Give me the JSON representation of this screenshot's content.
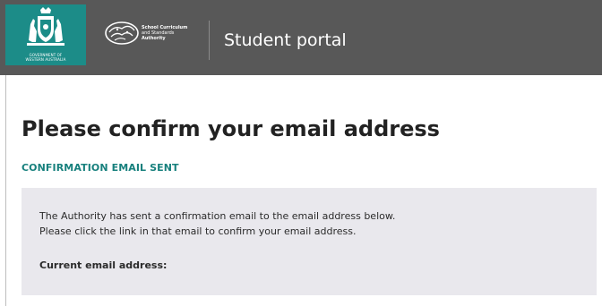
{
  "header": {
    "gov_logo_text_line1": "GOVERNMENT OF",
    "gov_logo_text_line2": "WESTERN AUSTRALIA",
    "scsa_line1": "School Curriculum",
    "scsa_line2": "and Standards",
    "scsa_line3": "Authority",
    "portal_title": "Student portal",
    "bar_color": "#585858",
    "crest_color": "#1c8c88"
  },
  "main": {
    "page_title": "Please confirm your email address",
    "status_heading": "CONFIRMATION EMAIL SENT",
    "message_line1": "The Authority has sent a confirmation email to the email address below.",
    "message_line2": "Please click the link in that email to confirm your email address.",
    "current_email_label": "Current email address:",
    "accent_color": "#17807d",
    "panel_color": "#e9e8ed"
  }
}
